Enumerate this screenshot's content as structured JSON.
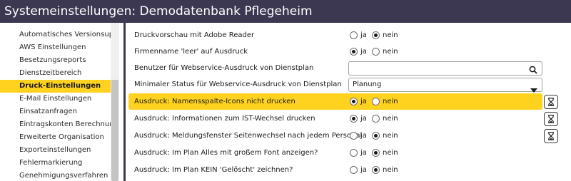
{
  "window": {
    "title": "Systemeinstellungen: Demodatenbank Pflegeheim"
  },
  "sidebar": {
    "items": [
      {
        "label": "Automatisches Versionsupda",
        "active": false
      },
      {
        "label": "AWS Einstellungen",
        "active": false
      },
      {
        "label": "Besetzungsreports",
        "active": false
      },
      {
        "label": "Dienstzeitbereich",
        "active": false
      },
      {
        "label": "Druck-Einstellungen",
        "active": true
      },
      {
        "label": "E-Mail Einstellungen",
        "active": false
      },
      {
        "label": "Einsatzanfragen",
        "active": false
      },
      {
        "label": "Eintragskonten Berechnung",
        "active": false
      },
      {
        "label": "Erweiterte Organisation",
        "active": false
      },
      {
        "label": "Exporteinstellungen",
        "active": false
      },
      {
        "label": "Fehlermarkierung",
        "active": false
      },
      {
        "label": "Genehmigungsverfahren",
        "active": false
      }
    ]
  },
  "settings": {
    "rows": [
      {
        "label": "Druckvorschau mit Adobe Reader",
        "control": "radio",
        "yes_label": "ja",
        "no_label": "nein",
        "selected": "nein"
      },
      {
        "label": "Firmenname 'leer' auf Ausdruck",
        "control": "radio",
        "yes_label": "ja",
        "no_label": "nein",
        "selected": "ja"
      },
      {
        "label": "Benutzer für Webservice-Ausdruck von Dienstplan",
        "control": "search",
        "value": "",
        "icon": "search-icon"
      },
      {
        "label": "Minimaler Status für Webservice-Ausdruck von Dienstplan",
        "control": "select",
        "value": "Planung",
        "icon": "chevron-down-icon"
      },
      {
        "label": "Ausdruck: Namensspalte-Icons nicht drucken",
        "control": "radio",
        "yes_label": "ja",
        "no_label": "nein",
        "selected": "ja",
        "highlighted": true,
        "action_icon": "hourglass-icon"
      },
      {
        "label": "Ausdruck: Informationen zum IST-Wechsel drucken",
        "control": "radio",
        "yes_label": "ja",
        "no_label": "nein",
        "selected": "ja",
        "action_icon": "hourglass-icon"
      },
      {
        "label": "Ausdruck: Meldungsfenster Seitenwechsel nach jedem Personal",
        "control": "radio",
        "yes_label": "ja",
        "no_label": "nein",
        "selected": "nein",
        "action_icon": "hourglass-icon"
      },
      {
        "label": "Ausdruck: Im Plan Alles mit großem Font anzeigen?",
        "control": "radio",
        "yes_label": "ja",
        "no_label": "nein",
        "selected": "nein"
      },
      {
        "label": "Ausdruck: Im Plan KEIN 'Gelöscht' zeichnen?",
        "control": "radio",
        "yes_label": "ja",
        "no_label": "nein",
        "selected": "nein"
      }
    ]
  },
  "colors": {
    "titlebar": "#3d3852",
    "highlight": "#ffd21f",
    "title_text": "#ffffff"
  }
}
